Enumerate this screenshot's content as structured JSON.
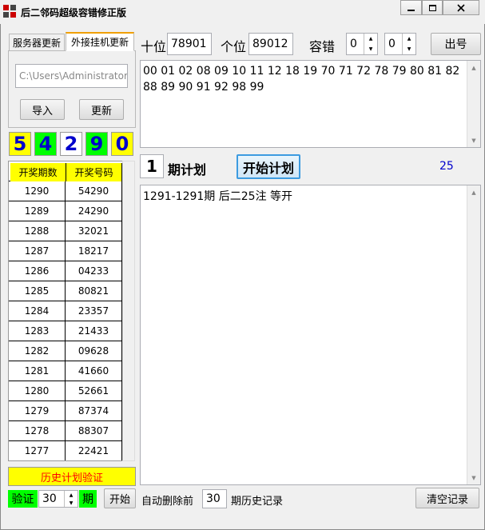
{
  "window": {
    "title": "后二邻码超级容错修正版"
  },
  "tabs": [
    {
      "label": "服务器更新"
    },
    {
      "label": "外接挂机更新"
    }
  ],
  "path_input": {
    "value": "C:\\Users\\Administrator\\"
  },
  "buttons": {
    "import": "导入",
    "update": "更新",
    "output": "出号",
    "start_plan": "开始计划",
    "start": "开始",
    "clear": "清空记录"
  },
  "digits": [
    "5",
    "4",
    "2",
    "9",
    "0"
  ],
  "digit_colors": [
    "#ffff00",
    "#00ff00",
    "#ffffff",
    "#00ff00",
    "#ffff00"
  ],
  "top": {
    "tens_label": "十位",
    "tens_value": "78901",
    "units_label": "个位",
    "units_value": "89012",
    "tolerance_label": "容错",
    "tol1": "0",
    "tol2": "0"
  },
  "numbers_text": "00 01 02 08 09 10 11 12 18 19 70 71 72 78 79 80 81 82 88 89 90 91 92 98 99",
  "plan": {
    "periods": "1",
    "label": "期计划",
    "count": "25"
  },
  "result_text": "1291-1291期 后二25注 等开",
  "table": {
    "headers": [
      "开奖期数",
      "开奖号码"
    ],
    "rows": [
      [
        "1290",
        "54290"
      ],
      [
        "1289",
        "24290"
      ],
      [
        "1288",
        "32021"
      ],
      [
        "1287",
        "18217"
      ],
      [
        "1286",
        "04233"
      ],
      [
        "1285",
        "80821"
      ],
      [
        "1284",
        "23357"
      ],
      [
        "1283",
        "21433"
      ],
      [
        "1282",
        "09628"
      ],
      [
        "1281",
        "41660"
      ],
      [
        "1280",
        "52661"
      ],
      [
        "1279",
        "87374"
      ],
      [
        "1278",
        "88307"
      ],
      [
        "1277",
        "22421"
      ]
    ]
  },
  "history_verify": "历史计划验证",
  "bottom": {
    "verify_label": "验证",
    "verify_value": "30",
    "period_label": "期",
    "auto_delete_label": "自动删除前",
    "auto_delete_value": "30",
    "history_label": "期历史记录"
  },
  "colors": {
    "yellow": "#ffff00",
    "green": "#00ff00",
    "digit_text": "#0000cc",
    "accent_blue": "#0000cc",
    "red_text": "#ff0000"
  }
}
